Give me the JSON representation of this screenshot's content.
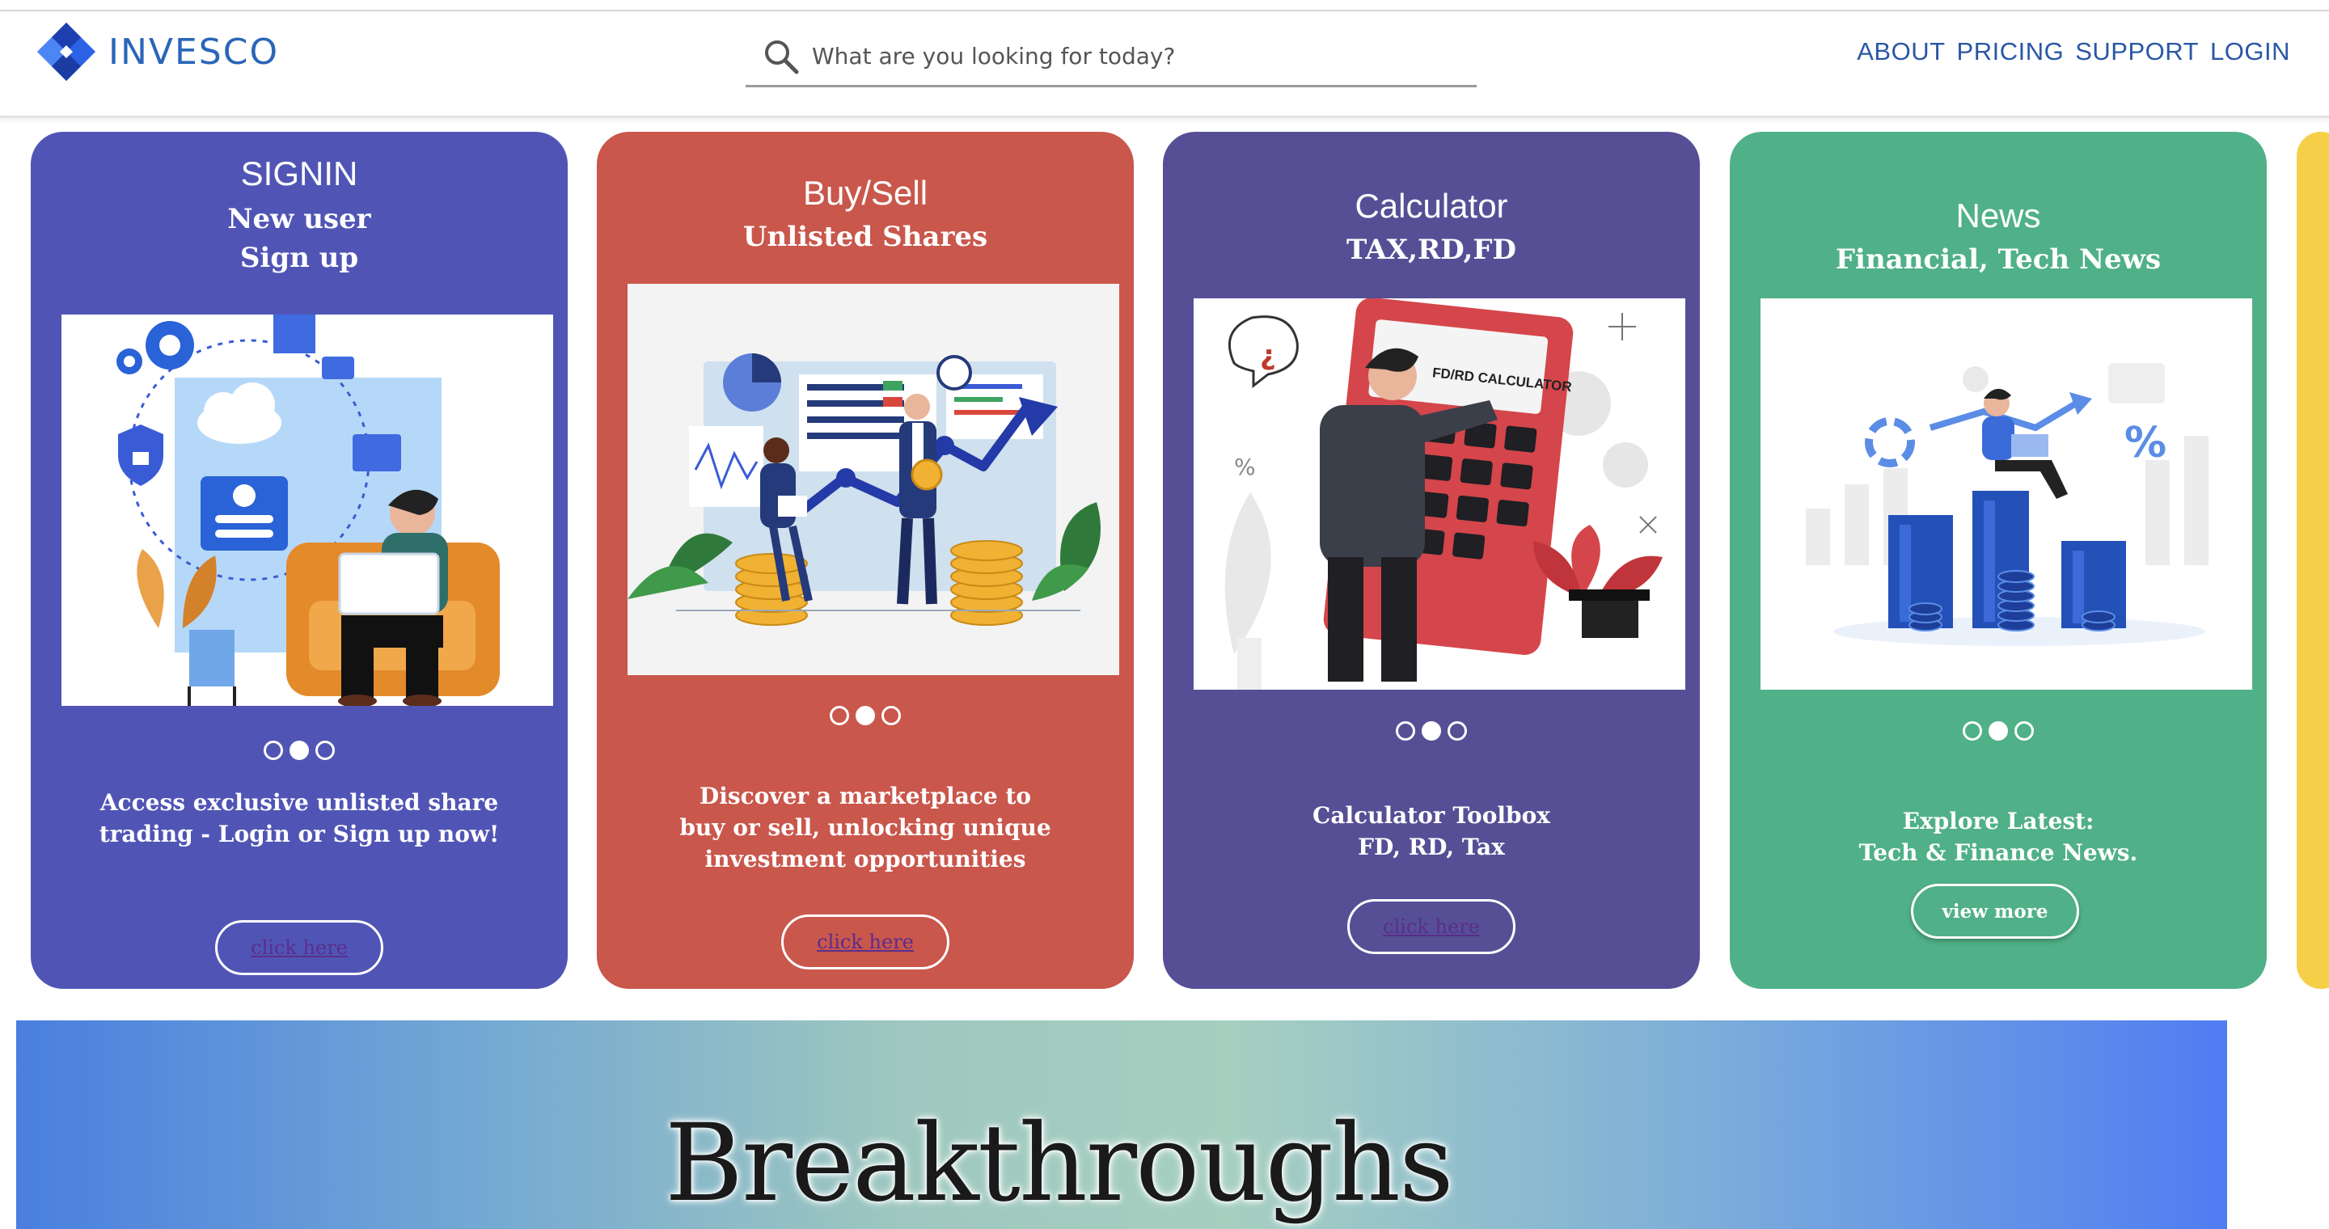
{
  "header": {
    "logo_text": "INVESCO",
    "search_placeholder": "What are you looking for today?",
    "nav": [
      "ABOUT",
      "PRICING",
      "SUPPORT",
      "LOGIN"
    ]
  },
  "cards": [
    {
      "title": "SIGNIN",
      "subtitle_1": "New user",
      "subtitle_2": "Sign up",
      "description_1": "Access exclusive unlisted share",
      "description_2": "trading - Login or Sign up now!",
      "button": "click here",
      "color": "#5055b5"
    },
    {
      "title": "Buy/Sell",
      "subtitle_1": "Unlisted Shares",
      "description_1": "Discover a marketplace to",
      "description_2": "buy or sell, unlocking unique",
      "description_3": "investment opportunities",
      "button": "click here",
      "color": "#c9574c"
    },
    {
      "title": "Calculator",
      "subtitle_1": "TAX,RD,FD",
      "illustration_label": "FD/RD CALCULATOR",
      "description_1": "Calculator Toolbox",
      "description_2": "FD, RD, Tax",
      "button": "click here",
      "color": "#574f95"
    },
    {
      "title": "News",
      "subtitle_1": "Financial, Tech News",
      "description_1": "Explore Latest:",
      "description_2": "Tech & Finance News.",
      "button": "view more",
      "color": "#50b087"
    }
  ],
  "carousel": {
    "dot_count": 3,
    "active_dot": 2
  },
  "banner": {
    "headline": "Breakthroughs"
  }
}
